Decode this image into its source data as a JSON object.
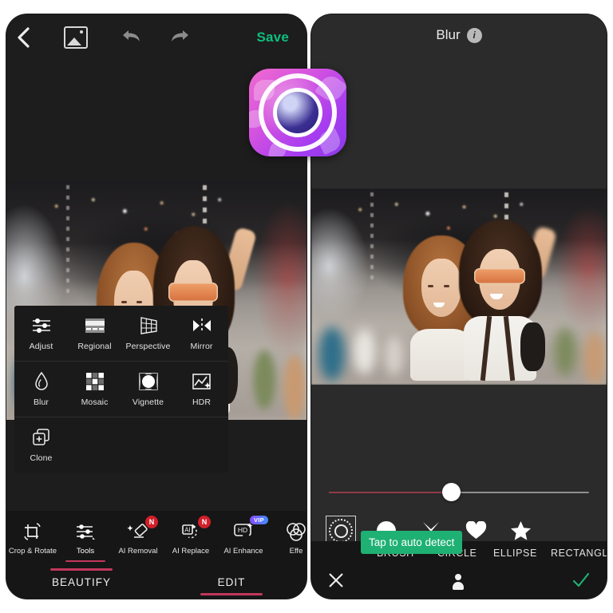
{
  "left_phone": {
    "topbar": {
      "back_icon": "chevron-left-icon",
      "gallery_icon": "photo-icon",
      "undo_icon": "undo-arrow-icon",
      "redo_icon": "redo-arrow-icon",
      "save_label": "Save",
      "save_color": "#0fbf7e"
    },
    "tools_grid": [
      {
        "label": "Adjust",
        "icon": "sliders-icon"
      },
      {
        "label": "Regional",
        "icon": "regional-gradient-icon"
      },
      {
        "label": "Perspective",
        "icon": "perspective-grid-icon"
      },
      {
        "label": "Mirror",
        "icon": "mirror-icon"
      },
      {
        "label": "Blur",
        "icon": "water-drop-icon"
      },
      {
        "label": "Mosaic",
        "icon": "mosaic-grid-icon"
      },
      {
        "label": "Vignette",
        "icon": "vignette-icon"
      },
      {
        "label": "HDR",
        "icon": "hdr-photo-icon"
      },
      {
        "label": "Clone",
        "icon": "clone-plus-icon"
      }
    ],
    "bottom_tools": [
      {
        "label": "Crop & Rotate",
        "icon": "crop-rotate-icon",
        "badge": "",
        "active": false
      },
      {
        "label": "Tools",
        "icon": "sliders-icon",
        "badge": "",
        "active": true
      },
      {
        "label": "AI Removal",
        "icon": "eraser-sparkle-icon",
        "badge": "N",
        "active": false
      },
      {
        "label": "AI Replace",
        "icon": "ai-replace-icon",
        "badge": "N",
        "active": false
      },
      {
        "label": "AI Enhance",
        "icon": "hd-sparkle-icon",
        "badge": "VIP",
        "active": false
      },
      {
        "label": "Effe",
        "icon": "effects-circles-icon",
        "badge": "",
        "active": false
      }
    ],
    "tabs": [
      {
        "label": "BEAUTIFY",
        "active": false
      },
      {
        "label": "EDIT",
        "active": true
      }
    ],
    "accent_color": "#c2365c",
    "badge_new_color": "#d11f2a"
  },
  "app_icon": {
    "name": "youcam-perfect-app-icon",
    "gradient_from": "#f06ad0",
    "gradient_to": "#8b3ae8"
  },
  "right_phone": {
    "topbar": {
      "title": "Blur",
      "info_glyph": "i",
      "info_icon": "info-icon"
    },
    "compare_icon": "compare-before-after-icon",
    "slider": {
      "value_percent": 47,
      "fill_color": "#8f3a48",
      "track_color": "#8f8f8f"
    },
    "shapes": [
      {
        "name": "auto-detect-shape",
        "selected": true
      },
      {
        "name": "circle-shape",
        "selected": false
      },
      {
        "name": "cross-shape",
        "selected": false
      },
      {
        "name": "heart-shape",
        "selected": false
      },
      {
        "name": "star-shape",
        "selected": false
      }
    ],
    "tooltip": {
      "text": "Tap to auto detect",
      "background": "#1fb073"
    },
    "mode_tabs": [
      {
        "label": "BRUSH",
        "active": false
      },
      {
        "label": "CIRCLE",
        "active": false
      },
      {
        "label": "ELLIPSE",
        "active": false
      },
      {
        "label": "RECTANGLE",
        "active": false
      }
    ],
    "bottom_bar": {
      "cancel_icon": "close-x-icon",
      "person_icon": "person-icon",
      "confirm_icon": "check-icon",
      "confirm_color": "#1fb073"
    }
  }
}
